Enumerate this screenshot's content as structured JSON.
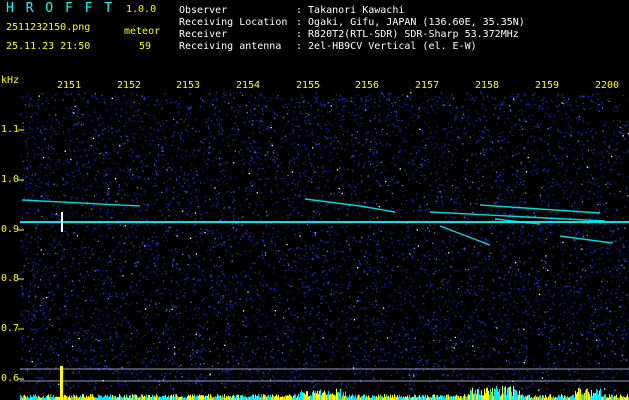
{
  "header": {
    "logo": "H R O F F T",
    "version": "1.0.0",
    "filename": "2511232150.png",
    "datetime": "25.11.23 21:50",
    "meteor_label": "meteor",
    "meteor_count": "59",
    "info": [
      {
        "label": "Observer",
        "value": ": Takanori Kawachi"
      },
      {
        "label": "Receiving Location",
        "value": ": Ogaki, Gifu, JAPAN (136.60E, 35.35N)"
      },
      {
        "label": "Receiver",
        "value": ": R820T2(RTL-SDR) SDR-Sharp 53.372MHz"
      },
      {
        "label": "Receiving antenna",
        "value": ": 2el-HB9CV Vertical (el. E-W)"
      }
    ]
  },
  "axis": {
    "unit": "kHz",
    "time_ticks": [
      "2151",
      "2152",
      "2153",
      "2154",
      "2155",
      "2156",
      "2157",
      "2158",
      "2159",
      "2200"
    ],
    "freq_ticks": [
      "1.1",
      "1.0",
      "0.9",
      "0.8",
      "0.7",
      "0.6"
    ]
  },
  "colors": {
    "background": "#000000",
    "text": "#ffff00",
    "info_text": "#ffffff",
    "noise": "#1a30c8",
    "signal": "#00ffff",
    "bars": "#ffff00"
  }
}
